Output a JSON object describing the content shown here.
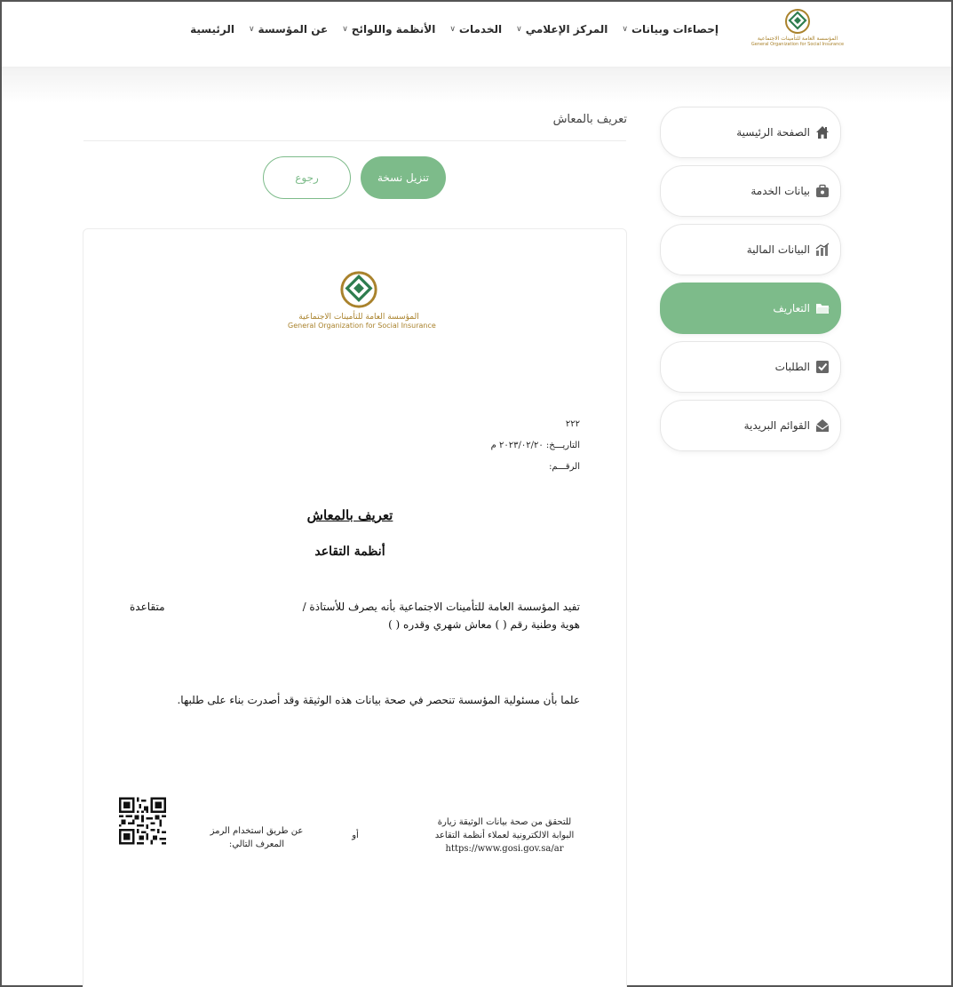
{
  "header": {
    "logo": {
      "name_ar": "المؤسسة العامة للتأمينات الاجتماعية",
      "name_en": "General Organization for Social Insurance"
    },
    "nav": [
      {
        "label": "الرئيسية",
        "has_dropdown": false
      },
      {
        "label": "عن المؤسسة",
        "has_dropdown": true
      },
      {
        "label": "الأنظمة واللوائح",
        "has_dropdown": true
      },
      {
        "label": "الخدمات",
        "has_dropdown": true
      },
      {
        "label": "المركز الإعلامي",
        "has_dropdown": true
      },
      {
        "label": "إحصاءات وبيانات",
        "has_dropdown": true
      }
    ],
    "chevron": "∨"
  },
  "sidebar": {
    "items": [
      {
        "label": "الصفحة الرئيسية",
        "icon": "home-icon",
        "active": false
      },
      {
        "label": "بيانات الخدمة",
        "icon": "briefcase-icon",
        "active": false
      },
      {
        "label": "البيانات المالية",
        "icon": "chart-icon",
        "active": false
      },
      {
        "label": "التعاريف",
        "icon": "folder-icon",
        "active": true
      },
      {
        "label": "الطلبات",
        "icon": "checkbox-icon",
        "active": false
      },
      {
        "label": "القوائم البريدية",
        "icon": "mail-icon",
        "active": false
      }
    ]
  },
  "content": {
    "title": "تعريف بالمعاش",
    "download_button": "تنزيل نسخة",
    "back_button": "رجوع"
  },
  "document": {
    "logo": {
      "name_ar": "المؤسسة العامة للتأمينات الاجتماعية",
      "name_en": "General Organization for Social Insurance"
    },
    "ref_code": "٢٢٢",
    "date_line": "التاريـــخ: ٢٠٢٣/٠٢/٢٠ م",
    "number_line": "الرقـــم:",
    "title": "تعريف بالمعاش",
    "subtitle": "أنظمة التقاعد",
    "para_line1": "تفيد المؤسسة العامة للتأمينات الاجتماعية بأنه يصرف للأستاذة /",
    "para_line1_end": "متقاعدة",
    "para_line2": "هوية وطنية رقم (              ) معاش شهري وقدره (        )",
    "disclaimer": "علما بأن مسئولية المؤسسة تنحصر في صحة بيانات هذه الوثيقة وقد أصدرت بناء على طلبها.",
    "verify_line1": "للتحقق من صحة بيانات الوثيقة زيارة",
    "verify_line2": "البوابة الالكترونية لعملاء أنظمة التقاعد",
    "verify_url": "https://www.gosi.gov.sa/ar",
    "or": "أو",
    "qr_line1": "عن طريق استخدام الرمز",
    "qr_line2": "المعرف التالي:"
  },
  "colors": {
    "accent": "#7dbb8a",
    "gold": "#a9822c",
    "logo_green": "#2e7d4f"
  }
}
